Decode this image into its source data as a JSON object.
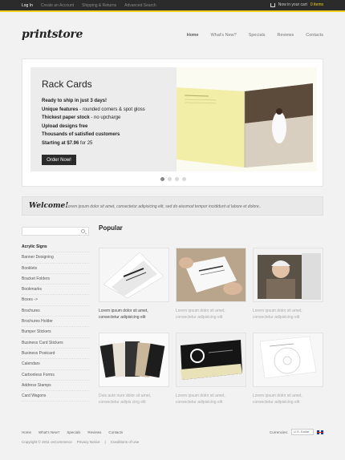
{
  "topbar": {
    "links": [
      "Log In",
      "Create an Account",
      "Shipping & Returns",
      "Advanced Search"
    ],
    "cart_text": "Now in your cart",
    "cart_items": "0 items"
  },
  "logo": "printstore",
  "nav": [
    "Home",
    "What's New?",
    "Specials",
    "Reviews",
    "Contacts"
  ],
  "slider": {
    "title": "Rack Cards",
    "line1": "Ready to ship in just 3 days!",
    "line2_bold": "Unique features",
    "line2_rest": " - rounded corners & spot gloss",
    "line3_bold": "Thickest paper stock",
    "line3_rest": " - no upcharge",
    "line4": "Upload designs free",
    "line5": "Thousands of satisfied customers",
    "line6_bold": "Starting at $7.96",
    "line6_rest": " for 25",
    "button": "Order Now!"
  },
  "welcome": {
    "title": "Welcome!",
    "text": "Lorem ipsum dolor sit amet, consectetur adipisicing elit, sed do eiusmod tempor incididunt ut labore et dolore.."
  },
  "categories": [
    "Acrylic Signs",
    "Banner Designing",
    "Booklets",
    "Bracket Folders",
    "Bookmarks",
    "Boxes ->",
    "Brochures",
    "Brochures Holder",
    "Bumper Stickers",
    "Business Card Stickers",
    "Business Postcard",
    "Calendars",
    "Carbonless Forms",
    "Address Stamps",
    "Card Wagons"
  ],
  "popular": {
    "title": "Popular",
    "items": [
      {
        "desc": "Lorem ipsum dolor sit amet, consectetur adipisicing elit"
      },
      {
        "desc": "Lorem ipsum dolor sit amet, consectetur adipisicing elit"
      },
      {
        "desc": "Lorem ipsum dolor sit amet, consectetur adipisicing elit"
      },
      {
        "desc": "Duis aute irure dolor sit amet, consectetur adipis cing elit"
      },
      {
        "desc": "Lorem ipsum dolor sit amet, consectetur adipisicing elit"
      },
      {
        "desc": "Lorem ipsum dolor sit amet, consectetur adipisicing elit"
      }
    ]
  },
  "footer": {
    "links": [
      "Home",
      "What's New?",
      "Specials",
      "Reviews",
      "Contacts"
    ],
    "copyright": "Copyright © 2011 osCommerce",
    "privacy": "Privacy Notice",
    "sep": "|",
    "conditions": "Conditions of Use",
    "currencies_label": "Currencies:",
    "currency_value": "U.S. Dollar"
  },
  "colors": {
    "accent": "#f3d21c",
    "topbar": "#2b2b2b"
  }
}
